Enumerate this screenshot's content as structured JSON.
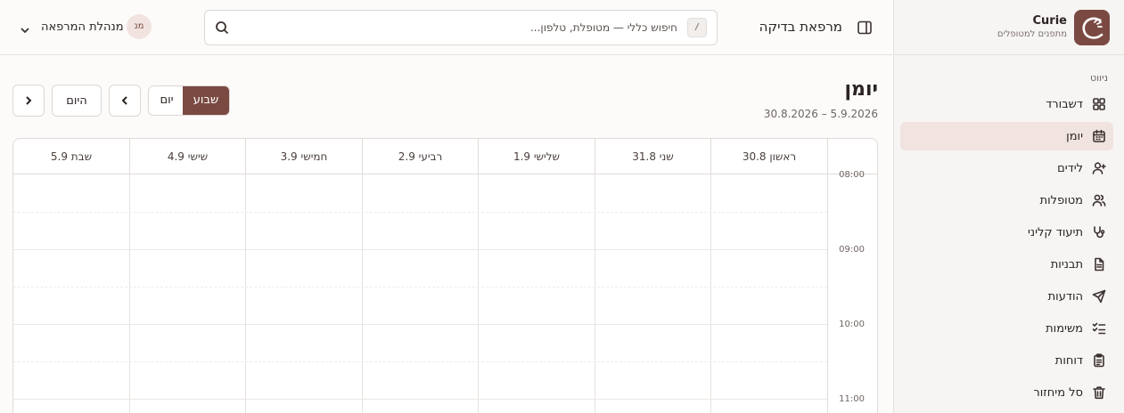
{
  "brand": {
    "name": "Curie",
    "tagline": "מתפנים למטופלים"
  },
  "sidebar": {
    "section_title": "ניווט",
    "items": [
      {
        "label": "דשבורד",
        "icon": "dashboard-icon"
      },
      {
        "label": "יומן",
        "icon": "calendar-icon",
        "active": true
      },
      {
        "label": "לידים",
        "icon": "user-plus-icon"
      },
      {
        "label": "מטופלות",
        "icon": "users-icon"
      },
      {
        "label": "תיעוד קליני",
        "icon": "stethoscope-icon"
      },
      {
        "label": "תבניות",
        "icon": "file-text-icon"
      },
      {
        "label": "הודעות",
        "icon": "send-icon"
      },
      {
        "label": "משימות",
        "icon": "list-checks-icon"
      },
      {
        "label": "דוחות",
        "icon": "clipboard-icon"
      },
      {
        "label": "סל מיחזור",
        "icon": "trash-icon"
      }
    ]
  },
  "topbar": {
    "clinic_name": "מרפאת בדיקה",
    "search_placeholder": "חיפוש כללי — מטופלת, טלפון...",
    "search_shortcut": "/",
    "user_name": "מנהלת המרפאה",
    "user_initials": "מנ"
  },
  "calendar": {
    "title": "יומן",
    "range": "30.8.2026 – 5.9.2026",
    "view_week": "שבוע",
    "view_day": "יום",
    "today_label": "היום",
    "days": [
      "ראשון 30.8",
      "שני 31.8",
      "שלישי 1.9",
      "רביעי 2.9",
      "חמישי 3.9",
      "שישי 4.9",
      "שבת 5.9"
    ],
    "hours": [
      "08:00",
      "09:00",
      "10:00",
      "11:00"
    ]
  },
  "colors": {
    "accent": "#7a4a42",
    "active_bg": "#f1e3e0"
  }
}
